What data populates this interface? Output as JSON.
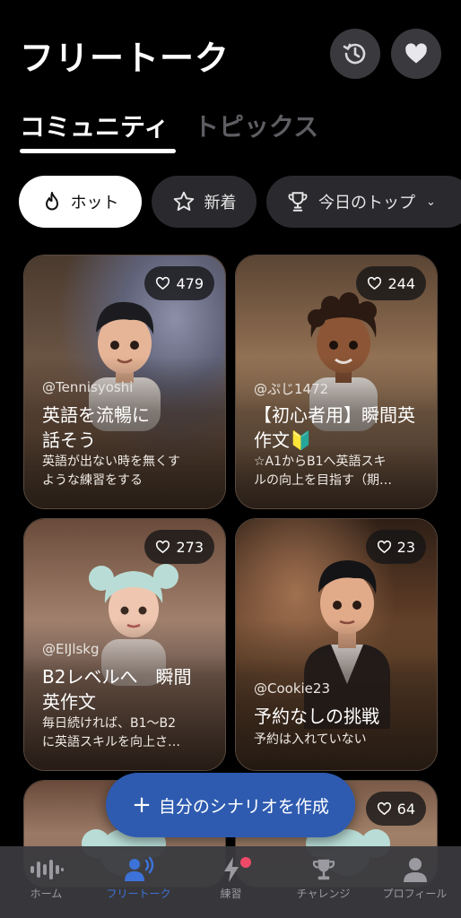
{
  "header": {
    "title": "フリートーク"
  },
  "tabs": [
    {
      "label": "コミュニティ",
      "active": true
    },
    {
      "label": "トピックス",
      "active": false
    }
  ],
  "filters": {
    "hot": "ホット",
    "new": "新着",
    "top": "今日のトップ"
  },
  "cards": [
    {
      "likes": "479",
      "user": "@Tennisyoshi",
      "title_line1": "英語を流暢に",
      "title_line2": "話そう",
      "desc_line1": "英語が出ない時を無くす",
      "desc_line2": "ような練習をする"
    },
    {
      "likes": "244",
      "user": "@ぷじ1472",
      "title_line1": "【初心者用】瞬間英",
      "title_line2": "作文🔰",
      "desc_line1": "☆A1からB1へ英語スキ",
      "desc_line2": "ルの向上を目指す（期…"
    },
    {
      "likes": "273",
      "user": "@EIJlskg",
      "title_line1": "B2レベルへ　瞬間",
      "title_line2": "英作文",
      "desc_line1": "毎日続ければ、B1～B2",
      "desc_line2": "に英語スキルを向上さ…"
    },
    {
      "likes": "23",
      "user": "@Cookie23",
      "title_line1": "予約なしの挑戦",
      "title_line2": "",
      "desc_line1": "予約は入れていない",
      "desc_line2": ""
    },
    {
      "likes": "",
      "user": "",
      "title_line1": "",
      "title_line2": "",
      "desc_line1": "",
      "desc_line2": ""
    },
    {
      "likes": "64",
      "user": "",
      "title_line1": "",
      "title_line2": "",
      "desc_line1": "",
      "desc_line2": ""
    }
  ],
  "fab": {
    "label": "自分のシナリオを作成"
  },
  "nav": [
    {
      "label": "ホーム",
      "icon": "waveform-icon"
    },
    {
      "label": "フリートーク",
      "icon": "person-voice-icon",
      "active": true
    },
    {
      "label": "練習",
      "icon": "bolt-icon"
    },
    {
      "label": "チャレンジ",
      "icon": "trophy-icon"
    },
    {
      "label": "プロフィール",
      "icon": "person-icon"
    }
  ],
  "colors": {
    "background": "#000000",
    "accent": "#3d72d8",
    "fab": "#2e5bb0",
    "badge": "#ef4a68"
  }
}
